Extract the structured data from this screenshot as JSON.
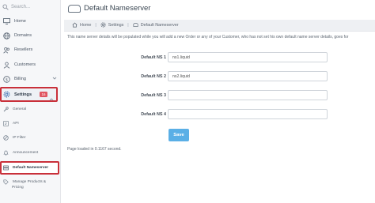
{
  "sidebar": {
    "search_placeholder": "Search...",
    "items": [
      {
        "label": "Home",
        "icon": "monitor-icon"
      },
      {
        "label": "Domains",
        "icon": "globe-icon"
      },
      {
        "label": "Resellers",
        "icon": "users-icon"
      },
      {
        "label": "Customers",
        "icon": "user-icon"
      },
      {
        "label": "Billing",
        "icon": "dollar-icon"
      },
      {
        "label": "Settings",
        "icon": "gear-icon",
        "badge": "16"
      }
    ],
    "sub_items": [
      {
        "label": "General",
        "icon": "wrench-icon"
      },
      {
        "label": "API",
        "icon": "code-icon"
      },
      {
        "label": "IP Filter",
        "icon": "filter-icon"
      },
      {
        "label": "Announcement",
        "icon": "bell-icon"
      },
      {
        "label": "Default Nameserver",
        "icon": "server-icon"
      },
      {
        "label": "Manage Products &",
        "label2": "Pricing",
        "icon": "tag-icon"
      }
    ]
  },
  "header": {
    "title": "Default Nameserver"
  },
  "breadcrumb": {
    "home": "Home",
    "settings": "Settings",
    "current": "Default Nameserver"
  },
  "description": "This name server details will be populated while you will add a new Order or any of your Customer, who has not set his own default name server details, goes for",
  "form": {
    "fields": [
      {
        "label": "Default NS 1",
        "value": "ns1.liquid"
      },
      {
        "label": "Default NS 2",
        "value": "ns2.liquid"
      },
      {
        "label": "Default NS 3",
        "value": ""
      },
      {
        "label": "Default NS 4",
        "value": ""
      }
    ],
    "save_label": "Save"
  },
  "footer": "Page loaded in 0.1167 second.",
  "colors": {
    "accent": "#5aafe6",
    "highlight_border": "#c9303a",
    "badge": "#e05561"
  }
}
